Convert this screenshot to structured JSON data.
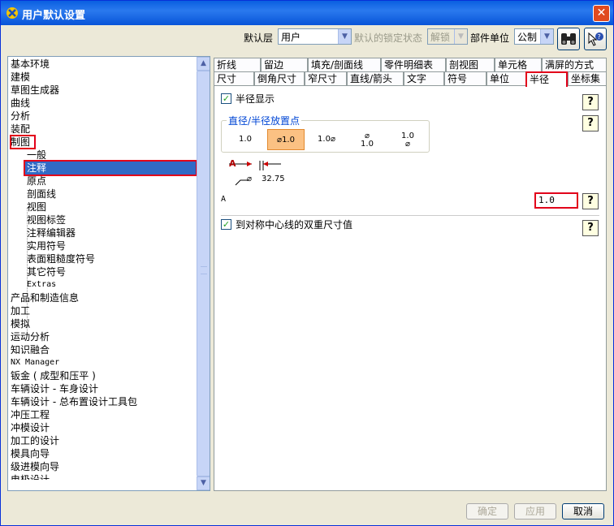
{
  "window": {
    "title": "用户默认设置",
    "close": "✕"
  },
  "toolbar": {
    "level_label": "默认层",
    "level_value": "用户",
    "lock_label": "默认的锁定状态",
    "lock_value": "解锁",
    "unit_label": "部件单位",
    "unit_value": "公制"
  },
  "tree": {
    "items": [
      "基本环境",
      "建模",
      "草图生成器",
      "曲线",
      "分析",
      "装配",
      "制图",
      "一般",
      "注释",
      "原点",
      "剖面线",
      "视图",
      "视图标签",
      "注释编辑器",
      "实用符号",
      "表面粗糙度符号",
      "其它符号",
      "Extras",
      "产品和制造信息",
      "加工",
      "模拟",
      "运动分析",
      "知识融合",
      "NX Manager",
      "钣金 ( 成型和压平 )",
      "车辆设计 - 车身设计",
      "车辆设计 - 总布置设计工具包",
      "冲压工程",
      "冲模设计",
      "加工的设计",
      "模具向导",
      "级进模向导",
      "电极设计"
    ]
  },
  "tabs": {
    "row1": [
      "折线",
      "留边",
      "填充/剖面线",
      "零件明细表",
      "剖视图",
      "单元格",
      "满屏的方式"
    ],
    "row2": [
      "尺寸",
      "倒角尺寸",
      "窄尺寸",
      "直线/箭头",
      "文字",
      "符号",
      "单位",
      "半径",
      "坐标集"
    ]
  },
  "panel": {
    "radius_display_label": "半径显示",
    "placement_group_label": "直径/半径放置点",
    "placement_options": {
      "opt1": "1.0",
      "opt2_sym": "⌀",
      "opt2_val": "1.0",
      "opt3_val": "1.0",
      "opt3_sym": "⌀",
      "opt4_sym": "⌀",
      "opt4_val": "1.0",
      "opt5_val": "1.0",
      "opt5_sym": "⌀"
    },
    "diagram": {
      "letter": "A",
      "value": "32.75"
    },
    "field_label": "A",
    "field_value": "1.0",
    "symmetric_label": "到对称中心线的双重尺寸值",
    "help_symbol": "?"
  },
  "buttons": {
    "ok": "确定",
    "apply": "应用",
    "cancel": "取消"
  }
}
